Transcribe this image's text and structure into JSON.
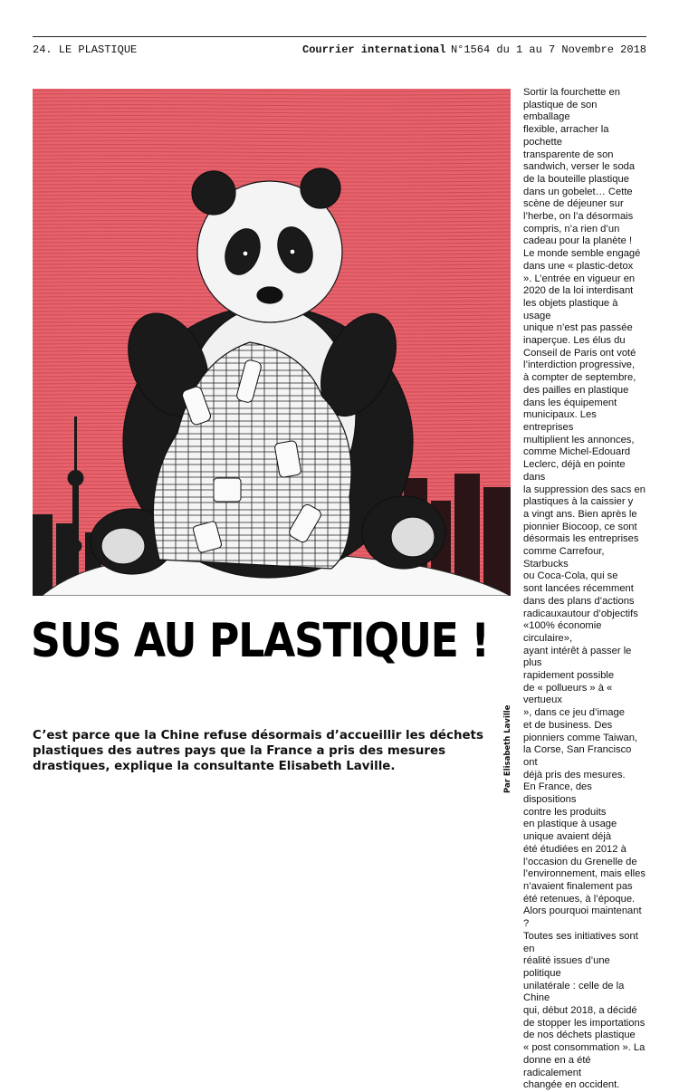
{
  "header": {
    "section": "24. LE PLASTIQUE",
    "publication": "Courrier international",
    "issue": "N°1564 du 1 au 7 Novembre 2018"
  },
  "colors": {
    "background_red": "#e8626c",
    "ink": "#111111"
  },
  "illustration": {
    "subject": "panda-with-plastic-waste"
  },
  "article": {
    "headline": "SUS AU PLASTIQUE !",
    "deck": "C’est parce que la Chine refuse désormais d’accueillir les déchets plastiques des autres pays que la France a pris des mesures drastiques, explique la consultante Elisabeth Laville.",
    "credit": "Par Elisabeth Laville",
    "body": "Sortir la fourchette en\nplastique de son emballage\nflexible, arracher la pochette\ntransparente de son\nsandwich, verser le soda\nde la bouteille plastique\ndans un gobelet… Cette\nscène de déjeuner sur\nl’herbe, on l’a désormais\ncompris, n’a rien d’un\ncadeau pour la planète !\nLe monde semble engagé\ndans une « plastic-detox\n». L’entrée en vigueur en\n2020 de la loi interdisant\nles objets plastique à usage\nunique n’est pas passée\ninaperçue. Les élus du\nConseil de Paris ont voté\nl’interdiction progressive,\nà compter de septembre,\ndes pailles en plastique\ndans les équipement\nmunicipaux. Les entreprises\nmultiplient les annonces,\ncomme Michel-Edouard\nLeclerc, déjà en pointe dans\nla suppression des sacs en\nplastiques à la caissier y\na vingt ans. Bien après le\npionnier Biocoop, ce sont\ndésormais les entreprises\ncomme Carrefour, Starbucks\nou Coca-Cola, qui se\nsont lancées récemment\ndans des plans d’actions\nradicauxautour d’objectifs\n«100% économie circulaire»,\nayant intérêt à passer le plus\nrapidement possible\nde « pollueurs » à « vertueux\n», dans ce jeu d’image\net de business. Des\npionniers comme Taiwan,\nla Corse, San Francisco ont\ndéjà pris des mesures.\nEn France, des dispositions\ncontre les produits\nen plastique à usage\nunique avaient déjà\nété étudiées en 2012 à\nl’occasion du Grenelle de\nl’environnement, mais elles\nn’avaient finalement pas\nété retenues, à l’époque.\nAlors pourquoi maintenant ?\nToutes ses initiatives sont en\nréalité issues d’une politique\nunilatérale : celle de la Chine\nqui, début 2018, a décidé\nde stopper les importations\nde nos déchets plastique\n« post consommation ». La\ndonne en a été radicalement\nchangée en occident."
  }
}
